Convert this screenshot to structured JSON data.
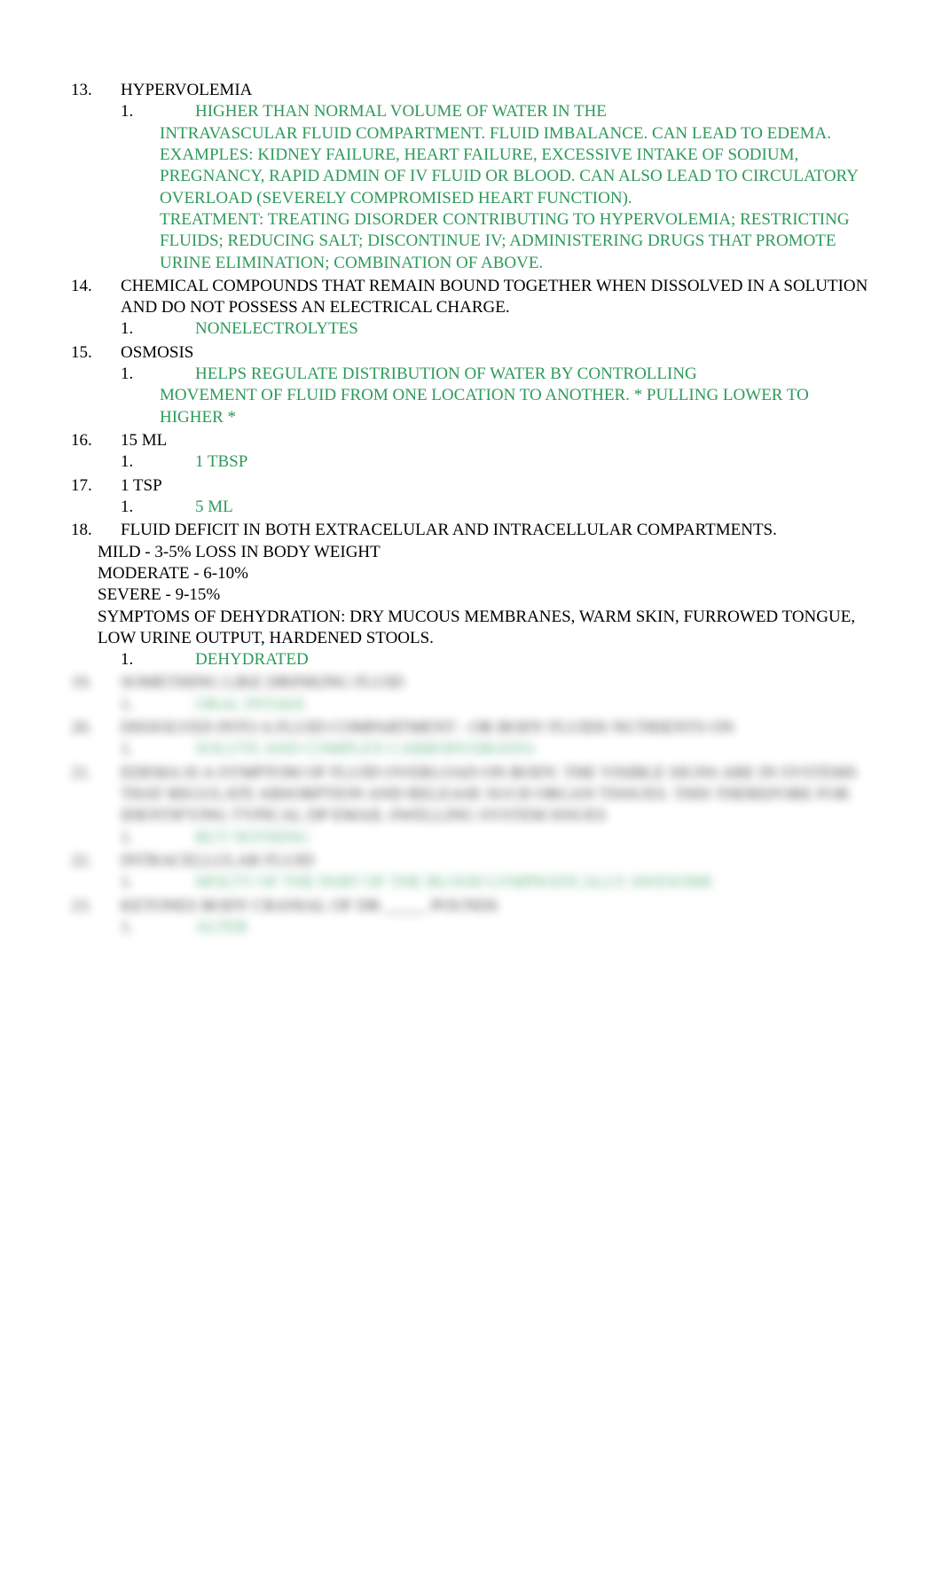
{
  "items": [
    {
      "num": "13.",
      "q_lines": [
        "HYPERVOLEMIA"
      ],
      "a_num": "1.",
      "a_lines": [
        "HIGHER THAN NORMAL VOLUME OF WATER IN THE",
        "INTRAVASCULAR FLUID COMPARTMENT. FLUID IMBALANCE. CAN LEAD TO EDEMA. EXAMPLES: KIDNEY FAILURE, HEART FAILURE, EXCESSIVE INTAKE OF SODIUM, PREGNANCY, RAPID ADMIN OF IV FLUID OR BLOOD. CAN ALSO LEAD TO CIRCULATORY OVERLOAD (SEVERELY COMPROMISED HEART FUNCTION).",
        "TREATMENT: TREATING DISORDER CONTRIBUTING TO HYPERVOLEMIA; RESTRICTING FLUIDS; REDUCING SALT; DISCONTINUE IV; ADMINISTERING DRUGS THAT PROMOTE URINE ELIMINATION; COMBINATION OF ABOVE."
      ]
    },
    {
      "num": "14.",
      "q_lines": [
        "CHEMICAL COMPOUNDS THAT REMAIN BOUND TOGETHER WHEN DISSOLVED IN A SOLUTION AND DO NOT POSSESS AN ELECTRICAL CHARGE."
      ],
      "a_num": "1.",
      "a_lines": [
        "NONELECTROLYTES"
      ]
    },
    {
      "num": "15.",
      "q_lines": [
        "OSMOSIS"
      ],
      "a_num": "1.",
      "a_lines": [
        "HELPS REGULATE DISTRIBUTION OF WATER BY CONTROLLING",
        "MOVEMENT OF FLUID FROM ONE LOCATION TO ANOTHER. *   PULLING LOWER TO HIGHER  *"
      ]
    },
    {
      "num": "16.",
      "q_lines": [
        "15 ML"
      ],
      "a_num": "1.",
      "a_lines": [
        "1 TBSP"
      ]
    },
    {
      "num": "17.",
      "q_lines": [
        "1 TSP"
      ],
      "a_num": "1.",
      "a_lines": [
        "5 ML"
      ]
    },
    {
      "num": "18.",
      "q_lines": [
        "FLUID DEFICIT IN BOTH EXTRACELULAR AND INTRACELLULAR COMPARTMENTS.",
        "MILD - 3-5% LOSS IN BODY WEIGHT",
        "MODERATE - 6-10%",
        "SEVERE - 9-15%",
        "SYMPTOMS OF DEHYDRATION: DRY MUCOUS MEMBRANES, WARM SKIN, FURROWED TONGUE, LOW URINE OUTPUT, HARDENED STOOLS."
      ],
      "a_num": "1.",
      "a_lines": [
        "DEHYDRATED"
      ]
    }
  ],
  "blurred_items": [
    {
      "num": "19.",
      "q_lines": [
        "SOMETHING LIKE DRINKING FLUID"
      ],
      "a_num": "1.",
      "a_lines": [
        "ORAL INTAKE"
      ]
    },
    {
      "num": "20.",
      "q_lines": [
        "DISSOLVED INTO A FLUID COMPARTMENT - OR BODY FLUIDS NUTRIENTS ON"
      ],
      "a_num": "1.",
      "a_lines": [
        "SOLUTE AND COMPLEX CARBOHYDRATES"
      ]
    },
    {
      "num": "21.",
      "q_lines": [
        "EDEMA IS A SYMPTOM OF FLUID OVERLOAD ON BODY. THE VISIBLE SIGNS ARE IN SYSTEMS THAT REGULATE ABSORPTION AND RELEASE SUCH ORGAN TISSUES. THIS THEREFORE FOR IDENTIFYING TYPICAL DP EMAIL SWELLING SYSTEM ISSUES"
      ],
      "a_num": "1.",
      "a_lines": [
        "BUT NOTHING"
      ]
    },
    {
      "num": "22.",
      "q_lines": [
        "INTRACELLULAR FLUID"
      ],
      "a_num": "1.",
      "a_lines": [
        "MOLTY OF THE PART OF THE BLOOD LYMPHATICALLY AWESOME"
      ]
    },
    {
      "num": "23.",
      "q_lines": [
        "KETONES BODY CRANIAL OF DR _____ POUNDS"
      ],
      "a_num": "1.",
      "a_lines": [
        "ALTER"
      ]
    }
  ]
}
